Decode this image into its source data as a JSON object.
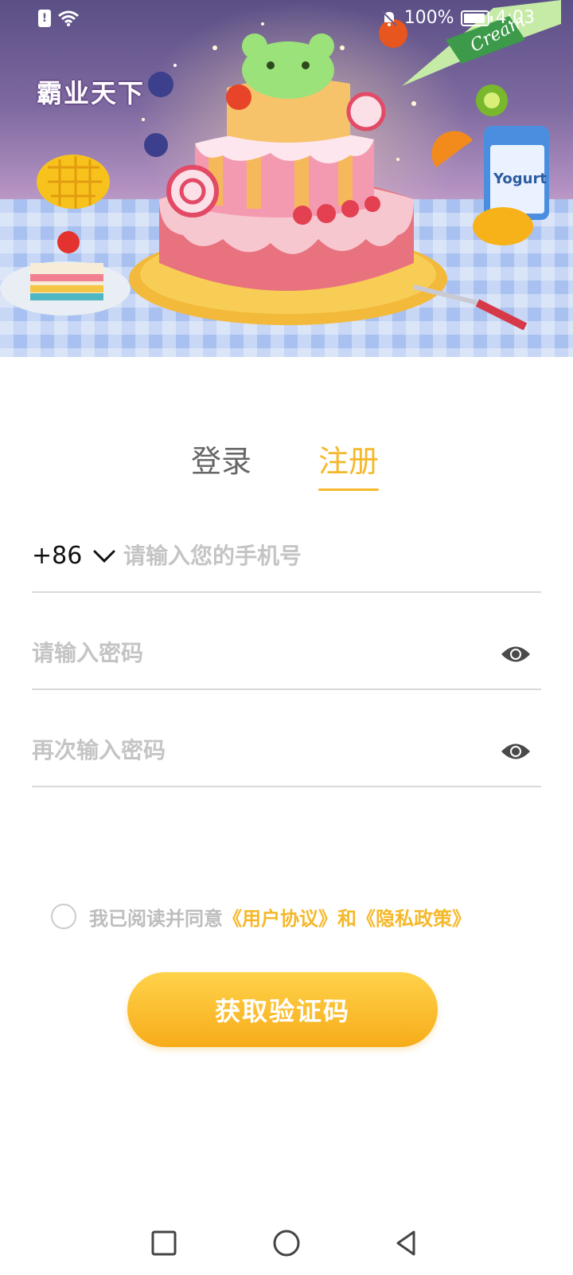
{
  "status_bar": {
    "sim_label": "!",
    "battery": "100%",
    "time": "4:03"
  },
  "banner": {
    "app_title": "霸业天下",
    "cream_label": "Cream",
    "yogurt_label": "Yogurt"
  },
  "tabs": {
    "login": "登录",
    "register": "注册",
    "active": "register"
  },
  "form": {
    "country_code": "+86",
    "phone_placeholder": "请输入您的手机号",
    "password_placeholder": "请输入密码",
    "confirm_password_placeholder": "再次输入密码"
  },
  "agreement": {
    "prefix": "我已阅读并同意",
    "user_agreement": "《用户协议》",
    "and": "和",
    "privacy_policy": "《隐私政策》",
    "checked": false
  },
  "buttons": {
    "get_code": "获取验证码"
  },
  "colors": {
    "accent": "#f5b82a",
    "button_top": "#ffd24a",
    "button_bottom": "#f7ac1a",
    "placeholder": "#c4c4c4"
  },
  "icons": {
    "status": [
      "sim-alert-icon",
      "wifi-icon",
      "mute-icon",
      "battery-icon"
    ],
    "fields": [
      "chevron-down-icon",
      "eye-icon"
    ],
    "nav": [
      "recent-apps-icon",
      "home-icon",
      "back-icon"
    ]
  }
}
